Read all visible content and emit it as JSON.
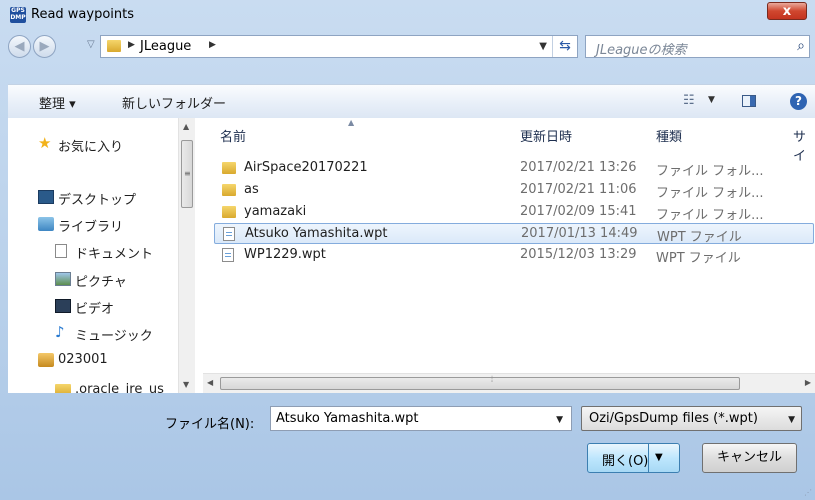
{
  "window": {
    "title": "Read waypoints",
    "app_icon_top": "GPS",
    "app_icon_bottom": "DMP",
    "close_label": "x"
  },
  "address_bar": {
    "path": "JLeague",
    "search_placeholder": "JLeagueの検索"
  },
  "toolbar": {
    "organize_label": "整理 ▾",
    "new_folder_label": "新しいフォルダー"
  },
  "nav_pane": {
    "items": [
      {
        "label": "お気に入り",
        "icon": "star-icon"
      },
      {
        "label": "デスクトップ",
        "icon": "desktop-icon"
      },
      {
        "label": "ライブラリ",
        "icon": "library-icon"
      },
      {
        "label": "ドキュメント",
        "icon": "document-icon"
      },
      {
        "label": "ピクチャ",
        "icon": "picture-icon"
      },
      {
        "label": "ビデオ",
        "icon": "video-icon"
      },
      {
        "label": "ミュージック",
        "icon": "music-icon"
      },
      {
        "label": "023001",
        "icon": "user-folder-icon"
      },
      {
        "label": ".oracle_jre_us",
        "icon": "folder-icon"
      }
    ]
  },
  "file_list": {
    "columns": [
      "名前",
      "更新日時",
      "種類",
      "サイ"
    ],
    "rows": [
      {
        "name": "AirSpace20170221",
        "date": "2017/02/21 13:26",
        "type": "ファイル フォル...",
        "kind": "folder",
        "selected": false
      },
      {
        "name": "as",
        "date": "2017/02/21 11:06",
        "type": "ファイル フォル...",
        "kind": "folder",
        "selected": false
      },
      {
        "name": "yamazaki",
        "date": "2017/02/09 15:41",
        "type": "ファイル フォル...",
        "kind": "folder",
        "selected": false
      },
      {
        "name": "Atsuko Yamashita.wpt",
        "date": "2017/01/13 14:49",
        "type": "WPT ファイル",
        "kind": "file",
        "selected": true
      },
      {
        "name": "WP1229.wpt",
        "date": "2015/12/03 13:29",
        "type": "WPT ファイル",
        "kind": "file",
        "selected": false
      }
    ]
  },
  "footer": {
    "filename_label": "ファイル名(N):",
    "filename_value": "Atsuko Yamashita.wpt",
    "filter_value": "Ozi/GpsDump files (*.wpt)",
    "open_label": "開く(O)",
    "cancel_label": "キャンセル"
  }
}
